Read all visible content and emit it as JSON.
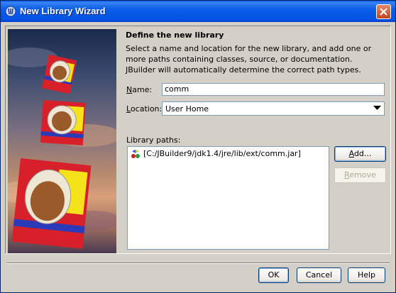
{
  "window": {
    "title": "New Library Wizard"
  },
  "content": {
    "heading": "Define the new library",
    "description": "Select a name and location for the new library, and add one or more paths containing classes, source, or documentation. JBuilder will automatically determine the correct path types."
  },
  "form": {
    "name_label_mnemonic": "N",
    "name_label_rest": "ame:",
    "name_value": "comm",
    "location_label_mnemonic": "L",
    "location_label_rest": "ocation:",
    "location_value": "User Home",
    "library_paths_label": "Library paths:",
    "library_paths": [
      "[C:/JBuilder9/jdk1.4/jre/lib/ext/comm.jar]"
    ]
  },
  "buttons": {
    "add_mnemonic": "A",
    "add_rest": "dd...",
    "remove_mnemonic": "R",
    "remove_rest": "emove",
    "ok": "OK",
    "cancel": "Cancel",
    "help": "Help"
  },
  "colors": {
    "titlebar": "#0054e3",
    "dialog_bg": "#d4d0c8",
    "field_border": "#7f9db9",
    "book_red": "#d8202a",
    "folder_yellow": "#f4e21a"
  },
  "icons": {
    "title": "jbuilder-icon",
    "close": "close-icon",
    "path": "library-path-icon",
    "dropdown": "chevron-down-icon"
  }
}
